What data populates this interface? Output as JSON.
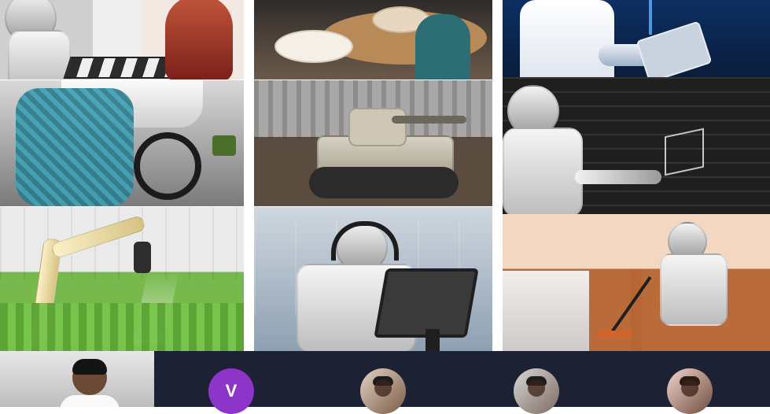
{
  "bottom_bar": {
    "participants": [
      {
        "initial": "V"
      }
    ]
  },
  "colors": {
    "meeting_bar": "#1c2233",
    "initial_avatar": "#8e35c9"
  }
}
